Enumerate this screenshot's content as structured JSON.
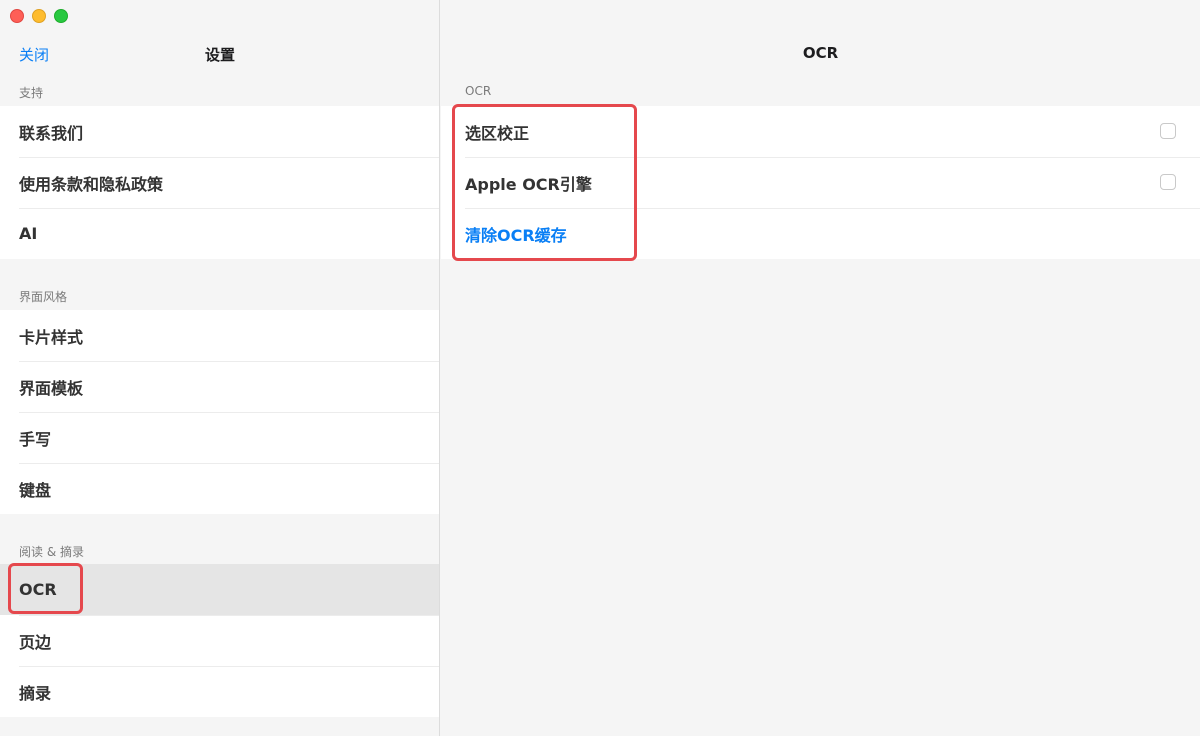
{
  "window": {
    "controls": [
      "close-control",
      "minimize-control",
      "zoom-control"
    ]
  },
  "sidebar": {
    "close_label": "关闭",
    "title": "设置",
    "sections": [
      {
        "header": "支持",
        "items": [
          {
            "label": "联系我们"
          },
          {
            "label": "使用条款和隐私政策"
          },
          {
            "label": "AI"
          }
        ]
      },
      {
        "header": "界面风格",
        "items": [
          {
            "label": "卡片样式"
          },
          {
            "label": "界面模板"
          },
          {
            "label": "手写"
          },
          {
            "label": "键盘"
          }
        ]
      },
      {
        "header": "阅读 & 摘录",
        "items": [
          {
            "label": "OCR",
            "selected": true
          },
          {
            "label": "页边"
          },
          {
            "label": "摘录"
          }
        ]
      }
    ]
  },
  "detail": {
    "title": "OCR",
    "section_header": "OCR",
    "items": [
      {
        "label": "选区校正",
        "checked": false
      },
      {
        "label": "Apple OCR引擎",
        "checked": false
      },
      {
        "label": "清除OCR缓存"
      }
    ]
  },
  "colors": {
    "accent": "#0a7ff5",
    "annotation": "#e5484d",
    "selected_row": "#e5e5e5"
  }
}
